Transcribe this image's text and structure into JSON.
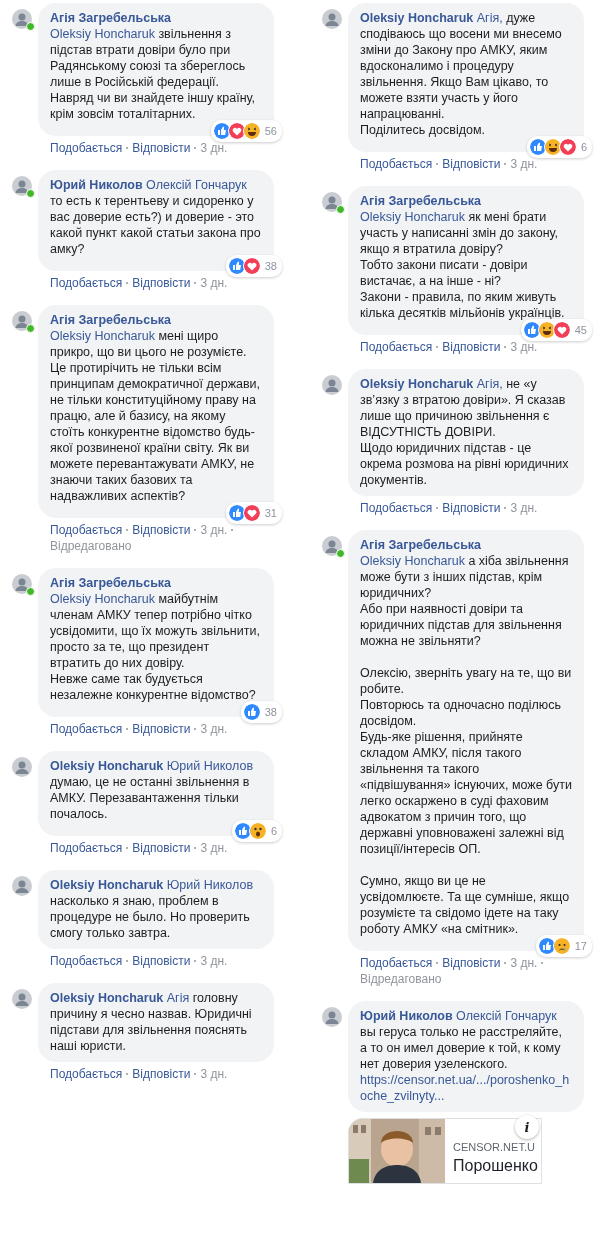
{
  "columns": [
    {
      "comments": [
        {
          "author": "Агія Загребельська",
          "mention": "Oleksiy Honcharuk",
          "text": "звільнення з підстав втрати довіри було при Радянському союзі та збереглось лише в Російській федерації. Навряд чи ви знайдете іншу країну, крім зовсім тоталітарних.",
          "online": true,
          "reactions": [
            {
              "kind": "like"
            },
            {
              "kind": "love"
            },
            {
              "kind": "haha"
            }
          ],
          "count": "56",
          "like": "Подобається",
          "reply": "Відповісти",
          "time": "3 дн."
        },
        {
          "author": "Юрий Николов",
          "mention": "Олексій Гончарук",
          "text": "то есть к терентьеву и сидоренко у вас доверие есть?) и доверие - это какой пункт какой статьи закона про амку?",
          "online": true,
          "reactions": [
            {
              "kind": "like"
            },
            {
              "kind": "love"
            }
          ],
          "count": "38",
          "like": "Подобається",
          "reply": "Відповісти",
          "time": "3 дн."
        },
        {
          "author": "Агія Загребельська",
          "mention": "Oleksiy Honcharuk",
          "text": "мені щиро прикро, що ви цього не розумієте. Це протирічить не тільки всім принципам демократичної держави, не тільки конституційному праву на працю, але й базису, на якому стоїть конкурентне відомство будь-якої розвиненої країни світу. Як ви можете перевантажувати АМКУ, не знаючи таких базових та надважливих аспектів?",
          "online": true,
          "reactions": [
            {
              "kind": "like"
            },
            {
              "kind": "love"
            }
          ],
          "count": "31",
          "like": "Подобається",
          "reply": "Відповісти",
          "time": "3 дн.",
          "edited": "Відредаговано"
        },
        {
          "author": "Агія Загребельська",
          "mention": "Oleksiy Honcharuk",
          "text": "майбутнім членам АМКУ тепер потрібно чітко усвідомити, що їх можуть звільнити, просто за те, що президент втратить до них довіру.\nНевже саме так будується незалежне конкурентне відомство?",
          "online": true,
          "reactions": [
            {
              "kind": "like"
            }
          ],
          "count": "38",
          "like": "Подобається",
          "reply": "Відповісти",
          "time": "3 дн."
        },
        {
          "author": "Oleksiy Honcharuk",
          "mention": "Юрий Николов",
          "text": "думаю, це не останні звільнення в АМКУ. Перезавантаження тільки почалось.",
          "online": false,
          "reactions": [
            {
              "kind": "like"
            },
            {
              "kind": "wow"
            }
          ],
          "count": "6",
          "like": "Подобається",
          "reply": "Відповісти",
          "time": "3 дн."
        },
        {
          "author": "Oleksiy Honcharuk",
          "mention": "Юрий Николов",
          "text": "насколько я знаю, проблем в процедуре не было. Но проверить смогу только завтра.",
          "online": false,
          "like": "Подобається",
          "reply": "Відповісти",
          "time": "3 дн."
        },
        {
          "author": "Oleksiy Honcharuk",
          "mention": "Агія",
          "text": "головну причину я чесно назвав. Юридичні підстави для звільнення пояснять наші юристи.",
          "online": false,
          "like": "Подобається",
          "reply": "Відповісти",
          "time": "3 дн."
        }
      ]
    },
    {
      "comments": [
        {
          "author": "Oleksiy Honcharuk",
          "mention": "Агія,",
          "text": "дуже сподіваюсь що восени ми внесемо зміни до Закону про АМКУ, яким вдосконалимо і процедуру звільнення. Якщо Вам цікаво, то можете взяти участь у його напрацюванні.\nПоділитесь досвідом.",
          "online": false,
          "reactions": [
            {
              "kind": "like"
            },
            {
              "kind": "haha"
            },
            {
              "kind": "love"
            }
          ],
          "count": "6",
          "like": "Подобається",
          "reply": "Відповісти",
          "time": "3 дн."
        },
        {
          "author": "Агія Загребельська",
          "mention": "Oleksiy Honcharuk",
          "text": "як мені брати участь у написанні змін до закону, якщо я втратила довіру?\nТобто закони писати - довіри вистачає, а на інше - ні?\nЗакони - правила, по яким живуть кілька десятків мільйонів українців.",
          "online": true,
          "reactions": [
            {
              "kind": "like"
            },
            {
              "kind": "haha"
            },
            {
              "kind": "love"
            }
          ],
          "count": "45",
          "like": "Подобається",
          "reply": "Відповісти",
          "time": "3 дн."
        },
        {
          "author": "Oleksiy Honcharuk",
          "mention": "Агія,",
          "text": "не «у зв’язку з втратою довіри». Я сказав лише що причиною звільнення є ВІДСУТНІСТЬ ДОВІРИ.\nЩодо юридичних підстав - це окрема розмова на рівні юридичних документів.",
          "online": false,
          "like": "Подобається",
          "reply": "Відповісти",
          "time": "3 дн."
        },
        {
          "author": "Агія Загребельська",
          "mention": "Oleksiy Honcharuk",
          "text": "а хіба звільнення може бути з інших підстав, крім юридичних?\nАбо при наявності довіри та юридичних підстав для звільнення можна не звільняти?\n\nОлексію, зверніть увагу на те, що ви робите.\nПовторюсь та одночасно поділюсь досвідом.\nБудь-яке рішення, прийняте складом АМКУ, після такого звільнення та такого «підвішування» існуючих, може бути легко оскаржено в суді фаховим адвокатом з причин того, що державні уповноважені залежні від позиції/інтересів ОП.\n\nСумно, якщо ви це не усвідомлюєте. Та ще сумніше, якщо розумієте та свідомо ідете на таку роботу АМКУ «на смітник».",
          "online": true,
          "reactions": [
            {
              "kind": "like"
            },
            {
              "kind": "sad"
            }
          ],
          "count": "17",
          "like": "Подобається",
          "reply": "Відповісти",
          "time": "3 дн.",
          "edited": "Відредаговано"
        },
        {
          "author": "Юрий Николов",
          "mention": "Олексій Гончарук",
          "text": "вы геруса только не расстреляйте, а то он имел доверие к той, к кому нет доверия узеленского.",
          "link": "https://censor.net.ua/.../poroshenko_hoche_zvilnyty...",
          "online": false,
          "preview": {
            "kind": "picture",
            "source": "CENSOR.NET.U",
            "title": "Порошенко",
            "info": "i"
          }
        }
      ]
    }
  ]
}
